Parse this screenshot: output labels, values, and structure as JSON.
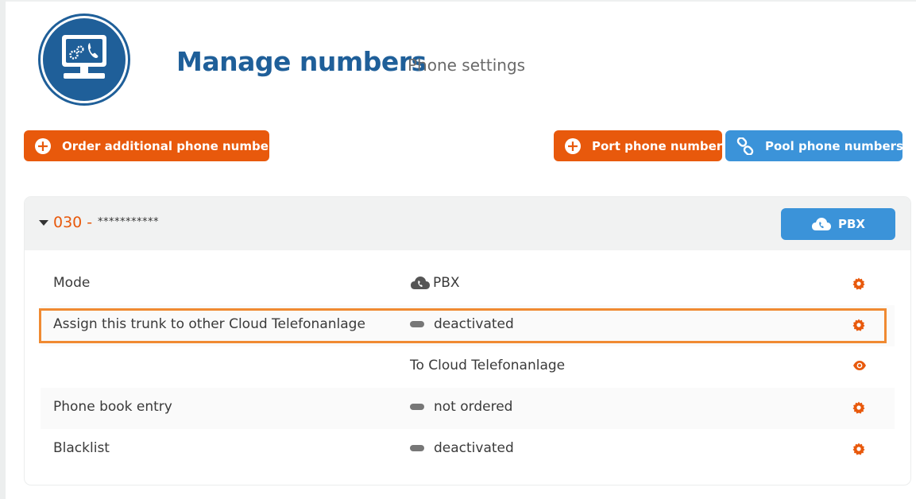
{
  "header": {
    "title": "Manage numbers",
    "subtitle": "Phone settings",
    "logo_icon": "computer-phone-icon"
  },
  "actions": {
    "order_label": "Order additional phone numbers",
    "port_label": "Port phone number",
    "pool_label": "Pool phone numbers"
  },
  "number": {
    "prefix": "030 -",
    "masked": "***********",
    "mode_button": "PBX"
  },
  "rows": [
    {
      "label": "Mode",
      "value": "PBX",
      "value_icon": "cloud-phone-icon",
      "action_icon": "gear-icon"
    },
    {
      "label": "Assign this trunk to other Cloud Telefonanlage",
      "value": "deactivated",
      "value_icon": "toggle-off-icon",
      "action_icon": "gear-icon"
    },
    {
      "label": "",
      "value": "To Cloud Telefonanlage",
      "value_icon": "",
      "action_icon": "eye-icon"
    },
    {
      "label": "Phone book entry",
      "value": "not ordered",
      "value_icon": "toggle-off-icon",
      "action_icon": "gear-icon"
    },
    {
      "label": "Blacklist",
      "value": "deactivated",
      "value_icon": "toggle-off-icon",
      "action_icon": "gear-icon"
    }
  ],
  "colors": {
    "brand_blue": "#1f5f99",
    "accent_orange": "#e8590c",
    "button_blue": "#3b93d9",
    "highlight": "#f08a32"
  }
}
